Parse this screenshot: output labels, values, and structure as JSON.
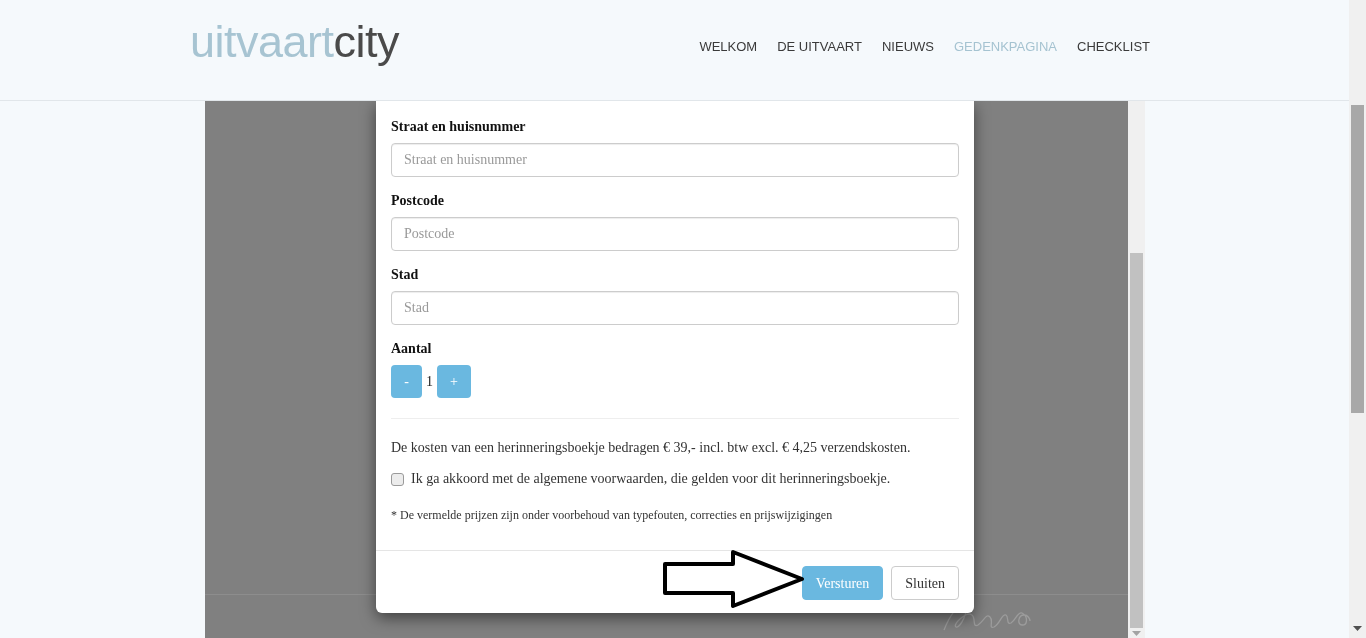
{
  "header": {
    "logo": {
      "text": "uitvaart",
      "accent": "city"
    },
    "nav": [
      {
        "label": "WELKOM",
        "selected": false
      },
      {
        "label": "DE UITVAART",
        "selected": false
      },
      {
        "label": "NIEUWS",
        "selected": false
      },
      {
        "label": "GEDENKPAGINA",
        "selected": true
      },
      {
        "label": "CHECKLIST",
        "selected": false
      }
    ]
  },
  "modal": {
    "fields": [
      {
        "label": "Straat en huisnummer",
        "placeholder": "Straat en huisnummer"
      },
      {
        "label": "Postcode",
        "placeholder": "Postcode"
      },
      {
        "label": "Stad",
        "placeholder": "Stad"
      }
    ],
    "quantity": {
      "label": "Aantal",
      "decrement": "-",
      "value": "1",
      "increment": "+"
    },
    "cost_note": "De kosten van een herinneringsboekje bedragen € 39,- incl. btw excl. € 4,25 verzendskosten.",
    "terms": {
      "label": "Ik ga akkoord met de algemene voorwaarden, die gelden voor dit herinneringsboekje.",
      "checked": false
    },
    "disclaimer": "* De vermelde prijzen zijn onder voorbehoud van typefouten, correcties en prijswijzigingen",
    "buttons": [
      {
        "label": "Versturen",
        "kind": "primary"
      },
      {
        "label": "Sluiten",
        "kind": "default"
      }
    ]
  }
}
